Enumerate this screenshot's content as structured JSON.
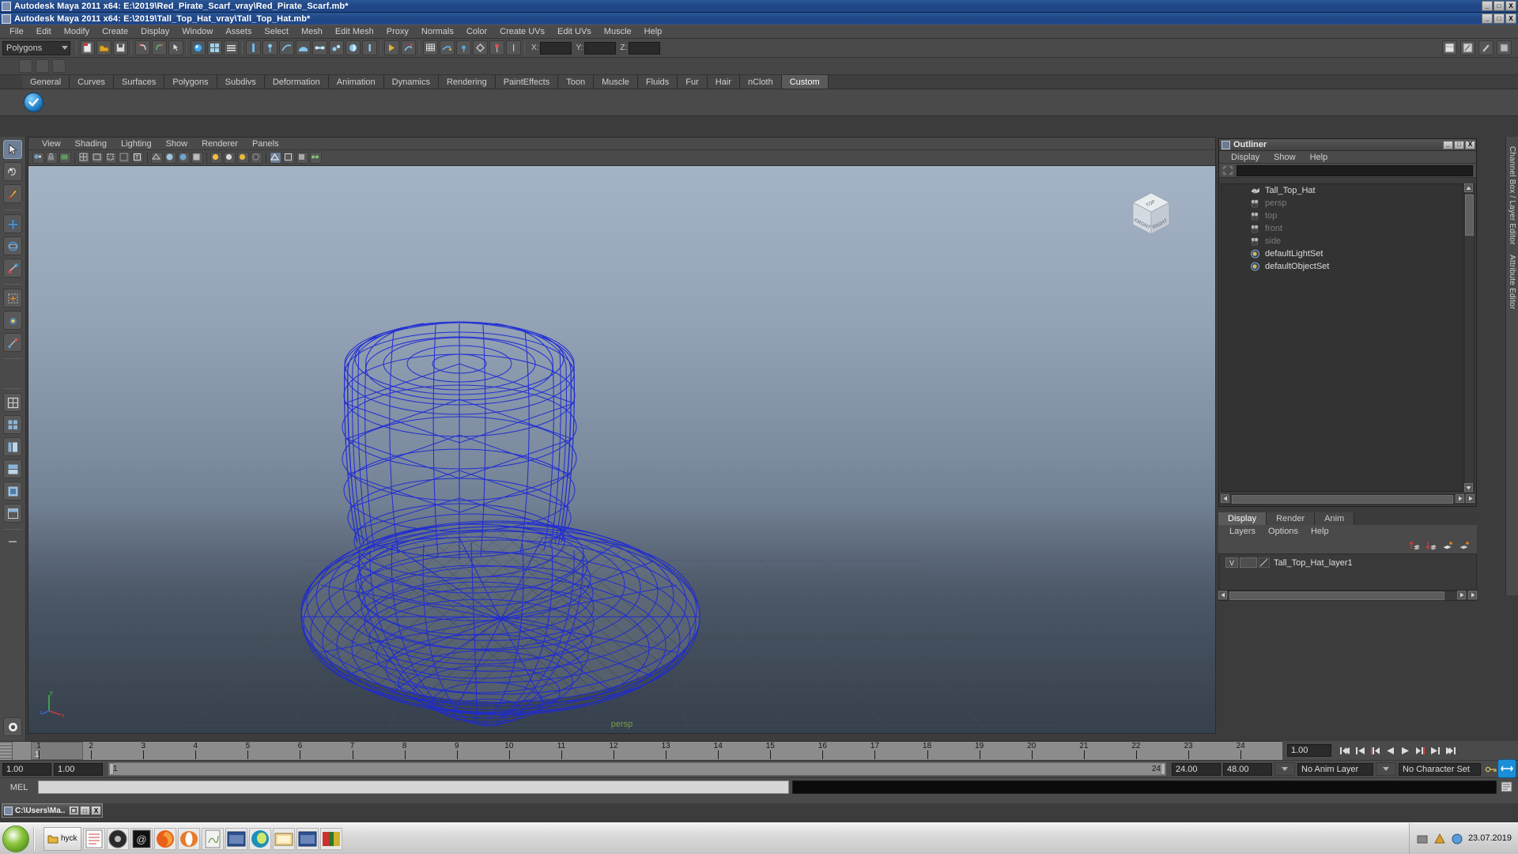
{
  "window": {
    "title_primary": "Autodesk Maya 2011 x64: E:\\2019\\Red_Pirate_Scarf_vray\\Red_Pirate_Scarf.mb*",
    "title_secondary": "Autodesk Maya 2011 x64: E:\\2019\\Tall_Top_Hat_vray\\Tall_Top_Hat.mb*",
    "minimize": "_",
    "maximize": "□",
    "close": "X"
  },
  "menubar": {
    "items": [
      "File",
      "Edit",
      "Modify",
      "Create",
      "Display",
      "Window",
      "Assets",
      "Select",
      "Mesh",
      "Edit Mesh",
      "Proxy",
      "Normals",
      "Color",
      "Create UVs",
      "Edit UVs",
      "Muscle",
      "Help"
    ]
  },
  "toolbar": {
    "mode": "Polygons",
    "axis_labels": [
      "X:",
      "Y:",
      "Z:"
    ],
    "coord_values": [
      "",
      "",
      ""
    ]
  },
  "shelf": {
    "tabs": [
      "General",
      "Curves",
      "Surfaces",
      "Polygons",
      "Subdivs",
      "Deformation",
      "Animation",
      "Dynamics",
      "Rendering",
      "PaintEffects",
      "Toon",
      "Muscle",
      "Fluids",
      "Fur",
      "Hair",
      "nCloth",
      "Custom"
    ],
    "active_tab": "Custom"
  },
  "viewport": {
    "menus": [
      "View",
      "Shading",
      "Lighting",
      "Show",
      "Renderer",
      "Panels"
    ],
    "camera_label": "persp",
    "axis": {
      "x": "x",
      "y": "y",
      "z": "z"
    },
    "viewcube": {
      "top": "TOP",
      "front": "FRONT",
      "right": "RIGHT"
    }
  },
  "outliner": {
    "title": "Outliner",
    "menus": [
      "Display",
      "Show",
      "Help"
    ],
    "search_value": "",
    "items": [
      {
        "label": "Tall_Top_Hat",
        "icon": "mesh-icon",
        "dim": false
      },
      {
        "label": "persp",
        "icon": "camera-icon",
        "dim": true
      },
      {
        "label": "top",
        "icon": "camera-icon",
        "dim": true
      },
      {
        "label": "front",
        "icon": "camera-icon",
        "dim": true
      },
      {
        "label": "side",
        "icon": "camera-icon",
        "dim": true
      },
      {
        "label": "defaultLightSet",
        "icon": "set-icon",
        "dim": false
      },
      {
        "label": "defaultObjectSet",
        "icon": "set-icon",
        "dim": false
      }
    ],
    "win_buttons": {
      "min": "_",
      "max": "□",
      "close": "X"
    }
  },
  "layer_editor": {
    "tabs": [
      "Display",
      "Render",
      "Anim"
    ],
    "active_tab": "Display",
    "menus": [
      "Layers",
      "Options",
      "Help"
    ],
    "layers": [
      {
        "visibility": "V",
        "mode": "",
        "name": "Tall_Top_Hat_layer1"
      }
    ]
  },
  "right_tabs": [
    "Channel Box / Layer Editor",
    "Attribute Editor"
  ],
  "timeline": {
    "start_frame": "1",
    "ticks": [
      1,
      2,
      3,
      4,
      5,
      6,
      7,
      8,
      9,
      10,
      11,
      12,
      13,
      14,
      15,
      16,
      17,
      18,
      19,
      20,
      21,
      22,
      23,
      24
    ],
    "current_frame": "1",
    "current_value": "1.00",
    "playback_buttons": [
      "go-to-start-icon",
      "step-back-key-icon",
      "step-back-frame-icon",
      "play-backwards-icon",
      "play-forwards-icon",
      "step-forward-frame-icon",
      "step-forward-key-icon",
      "go-to-end-icon"
    ]
  },
  "range_slider": {
    "anim_start": "1.00",
    "range_start": "1.00",
    "track_left_label": "1",
    "track_right_label": "24",
    "range_end": "24.00",
    "anim_end": "48.00",
    "anim_layer": "No Anim Layer",
    "character_set": "No Character Set"
  },
  "command_line": {
    "label": "MEL",
    "input_value": "",
    "output_value": ""
  },
  "console_window": {
    "title": "C:\\Users\\Ma..",
    "buttons": {
      "restore": "❐",
      "maximize": "□",
      "close": "X"
    }
  },
  "taskbar": {
    "start_label": "",
    "tasks": [
      "hyck"
    ],
    "clock_date": "23.07.2019",
    "clock_time": ""
  },
  "colors": {
    "titlebar_blue": "#21488a",
    "panel_gray": "#4a4a4a",
    "viewport_top": "#a4b3c6",
    "viewport_bottom": "#454f5d",
    "wireframe_blue": "#1e2ad6",
    "persp_green": "#7a9a4e"
  }
}
